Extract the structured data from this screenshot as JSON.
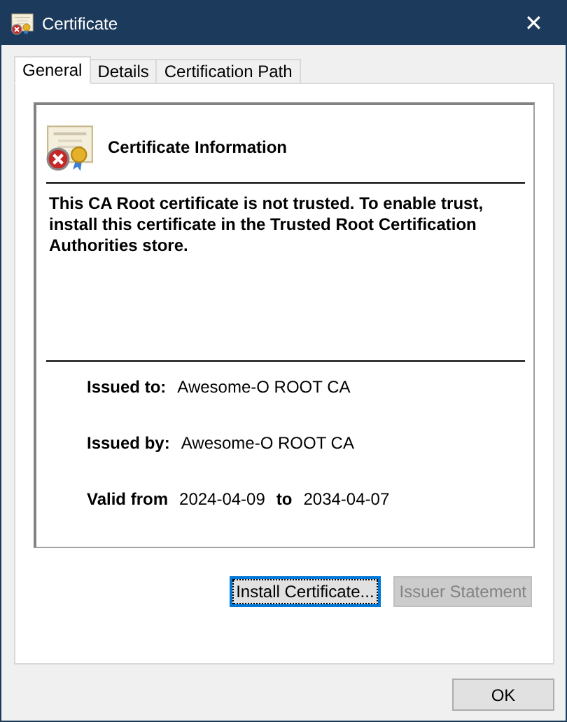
{
  "window": {
    "title": "Certificate",
    "close": "✕"
  },
  "tabs": [
    {
      "label": "General",
      "selected": true
    },
    {
      "label": "Details",
      "selected": false
    },
    {
      "label": "Certification Path",
      "selected": false
    }
  ],
  "info": {
    "heading": "Certificate Information",
    "trusted": false,
    "message": "This CA Root certificate is not trusted. To enable trust, install this certificate in the Trusted Root Certification Authorities store."
  },
  "fields": [
    {
      "label": "Issued to:",
      "value": "Awesome-O ROOT CA"
    },
    {
      "label": "Issued by:",
      "value": "Awesome-O ROOT CA"
    }
  ],
  "validity": {
    "from_label": "Valid from",
    "from": "2024-04-09",
    "to_label": "to",
    "to": "2034-04-07"
  },
  "panel_buttons": [
    {
      "label": "Install Certificate...",
      "disabled": false,
      "focused": true
    },
    {
      "label": "Issuer Statement",
      "disabled": true,
      "focused": false
    }
  ],
  "dialog_buttons": [
    {
      "label": "OK"
    }
  ]
}
